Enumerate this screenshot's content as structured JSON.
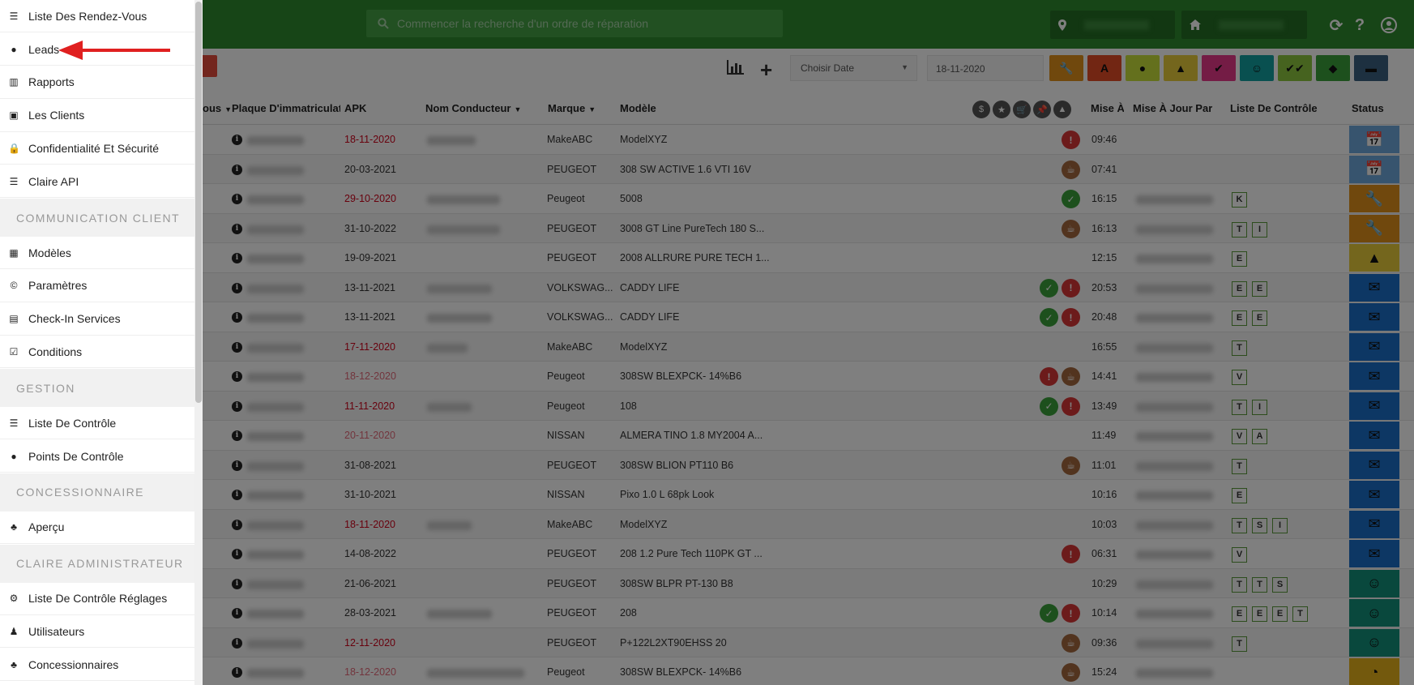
{
  "header": {
    "search_placeholder": "Commencer la recherche d'un ordre de réparation"
  },
  "toolbar": {
    "date_select": "Choisir Date",
    "date_value": "18-11-2020",
    "filter_buttons": [
      {
        "name": "wrench",
        "color": "#e0901a",
        "glyph": "🔧"
      },
      {
        "name": "alert-box",
        "color": "#e44d26",
        "glyph": "A"
      },
      {
        "name": "tag",
        "color": "#c8e03a",
        "glyph": "●"
      },
      {
        "name": "warning",
        "color": "#e8cc3a",
        "glyph": "▲"
      },
      {
        "name": "user-check",
        "color": "#e8388a",
        "glyph": "✔"
      },
      {
        "name": "face",
        "color": "#13a0a0",
        "glyph": "☺"
      },
      {
        "name": "double-check",
        "color": "#8cc63f",
        "glyph": "✔✔"
      },
      {
        "name": "shield",
        "color": "#3aa03a",
        "glyph": "◆"
      },
      {
        "name": "car",
        "color": "#3a6080",
        "glyph": "▬"
      }
    ]
  },
  "table": {
    "headers": {
      "col0": "ous",
      "plate": "Plaque D'immatriculatio",
      "apk": "APK",
      "driver": "Nom Conducteur",
      "brand": "Marque",
      "model": "Modèle",
      "update": "Mise À",
      "updated_by": "Mise À Jour Par",
      "checklist": "Liste De Contrôle",
      "status": "Status"
    },
    "header_icons": [
      "$",
      "★",
      "🛒",
      "📌",
      "▲"
    ],
    "rows": [
      {
        "apk": "18-11-2020",
        "apk_color": "red",
        "brand": "MakeABC",
        "model": "ModelXYZ",
        "time": "09:46",
        "icons": [
          "red"
        ],
        "checks": [],
        "status": "lightblue",
        "status_glyph": "📅"
      },
      {
        "apk": "20-03-2021",
        "apk_color": "normal",
        "brand": "PEUGEOT",
        "model": "308 SW ACTIVE 1.6 VTI 16V",
        "time": "07:41",
        "icons": [
          "brown"
        ],
        "checks": [],
        "status": "lightblue",
        "status_glyph": "📅"
      },
      {
        "apk": "29-10-2020",
        "apk_color": "red",
        "brand": "Peugeot",
        "model": "5008",
        "time": "16:15",
        "icons": [
          "green"
        ],
        "checks": [
          "K"
        ],
        "status": "orange",
        "status_glyph": "🔧"
      },
      {
        "apk": "31-10-2022",
        "apk_color": "normal",
        "brand": "PEUGEOT",
        "model": "3008 GT Line PureTech 180 S...",
        "time": "16:13",
        "icons": [
          "brown"
        ],
        "checks": [
          "T",
          "I"
        ],
        "status": "orange",
        "status_glyph": "🔧"
      },
      {
        "apk": "19-09-2021",
        "apk_color": "normal",
        "brand": "PEUGEOT",
        "model": "2008 ALLRURE PURE TECH 1...",
        "time": "12:15",
        "icons": [],
        "checks": [
          "E"
        ],
        "status": "yellow",
        "status_glyph": "▲"
      },
      {
        "apk": "13-11-2021",
        "apk_color": "normal",
        "brand": "VOLKSWAG...",
        "model": "CADDY LIFE",
        "time": "20:53",
        "icons": [
          "green",
          "red"
        ],
        "checks": [
          "E",
          "E"
        ],
        "status": "blue",
        "status_glyph": "✉"
      },
      {
        "apk": "13-11-2021",
        "apk_color": "normal",
        "brand": "VOLKSWAG...",
        "model": "CADDY LIFE",
        "time": "20:48",
        "icons": [
          "green",
          "red"
        ],
        "checks": [
          "E",
          "E"
        ],
        "status": "blue",
        "status_glyph": "✉"
      },
      {
        "apk": "17-11-2020",
        "apk_color": "red",
        "brand": "MakeABC",
        "model": "ModelXYZ",
        "time": "16:55",
        "icons": [],
        "checks": [
          "T"
        ],
        "status": "blue",
        "status_glyph": "✉"
      },
      {
        "apk": "18-12-2020",
        "apk_color": "pink",
        "brand": "Peugeot",
        "model": "308SW BLEXPCK- 14%B6",
        "time": "14:41",
        "icons": [
          "red",
          "brown"
        ],
        "checks": [
          "V"
        ],
        "status": "blue",
        "status_glyph": "✉"
      },
      {
        "apk": "11-11-2020",
        "apk_color": "red",
        "brand": "Peugeot",
        "model": "108",
        "time": "13:49",
        "icons": [
          "green",
          "red"
        ],
        "checks": [
          "T",
          "I"
        ],
        "status": "blue",
        "status_glyph": "✉"
      },
      {
        "apk": "20-11-2020",
        "apk_color": "pink",
        "brand": "NISSAN",
        "model": "ALMERA TINO 1.8 MY2004 A...",
        "time": "11:49",
        "icons": [],
        "checks": [
          "V",
          "A"
        ],
        "status": "blue",
        "status_glyph": "✉"
      },
      {
        "apk": "31-08-2021",
        "apk_color": "normal",
        "brand": "PEUGEOT",
        "model": "308SW BLION PT110 B6",
        "time": "11:01",
        "icons": [
          "brown"
        ],
        "checks": [
          "T"
        ],
        "status": "blue",
        "status_glyph": "✉"
      },
      {
        "apk": "31-10-2021",
        "apk_color": "normal",
        "brand": "NISSAN",
        "model": "Pixo 1.0 L 68pk Look",
        "time": "10:16",
        "icons": [],
        "checks": [
          "E"
        ],
        "status": "blue",
        "status_glyph": "✉"
      },
      {
        "apk": "18-11-2020",
        "apk_color": "red",
        "brand": "MakeABC",
        "model": "ModelXYZ",
        "time": "10:03",
        "icons": [],
        "checks": [
          "T",
          "S",
          "I"
        ],
        "status": "blue",
        "status_glyph": "✉"
      },
      {
        "apk": "14-08-2022",
        "apk_color": "normal",
        "brand": "PEUGEOT",
        "model": "208 1.2 Pure Tech 110PK GT ...",
        "time": "06:31",
        "icons": [
          "red"
        ],
        "checks": [
          "V"
        ],
        "status": "blue",
        "status_glyph": "✉"
      },
      {
        "apk": "21-06-2021",
        "apk_color": "normal",
        "brand": "PEUGEOT",
        "model": "308SW BLPR PT-130 B8",
        "time": "10:29",
        "icons": [],
        "checks": [
          "T",
          "T",
          "S"
        ],
        "status": "teal",
        "status_glyph": "☺"
      },
      {
        "apk": "28-03-2021",
        "apk_color": "normal",
        "brand": "PEUGEOT",
        "model": "208",
        "time": "10:14",
        "icons": [
          "green",
          "red"
        ],
        "checks": [
          "E",
          "E",
          "E",
          "T"
        ],
        "status": "teal",
        "status_glyph": "☺"
      },
      {
        "apk": "12-11-2020",
        "apk_color": "red",
        "brand": "PEUGEOT",
        "model": "P+122L2XT90EHSS 20",
        "time": "09:36",
        "icons": [
          "brown"
        ],
        "checks": [
          "T"
        ],
        "status": "teal",
        "status_glyph": "☺"
      },
      {
        "apk": "18-12-2020",
        "apk_color": "pink",
        "brand": "Peugeot",
        "model": "308SW BLEXPCK- 14%B6",
        "time": "15:24",
        "icons": [
          "brown"
        ],
        "checks": [],
        "status": "gold",
        "status_glyph": "◔"
      }
    ]
  },
  "sidebar": {
    "items": [
      {
        "type": "item",
        "label": "Liste Des Rendez-Vous",
        "icon": "list-icon",
        "glyph": "☰"
      },
      {
        "type": "item",
        "label": "Leads",
        "icon": "clock-icon",
        "glyph": "●"
      },
      {
        "type": "item",
        "label": "Rapports",
        "icon": "bar-chart-icon",
        "glyph": "▥"
      },
      {
        "type": "item",
        "label": "Les Clients",
        "icon": "id-card-icon",
        "glyph": "▣"
      },
      {
        "type": "item",
        "label": "Confidentialité Et Sécurité",
        "icon": "lock-icon",
        "glyph": "🔒"
      },
      {
        "type": "item",
        "label": "Claire API",
        "icon": "server-icon",
        "glyph": "☰"
      },
      {
        "type": "section",
        "label": "COMMUNICATION CLIENT"
      },
      {
        "type": "item",
        "label": "Modèles",
        "icon": "film-icon",
        "glyph": "▦"
      },
      {
        "type": "item",
        "label": "Paramètres",
        "icon": "cc-icon",
        "glyph": "©"
      },
      {
        "type": "item",
        "label": "Check-In Services",
        "icon": "table-icon",
        "glyph": "▤"
      },
      {
        "type": "item",
        "label": "Conditions",
        "icon": "checkbox-icon",
        "glyph": "☑"
      },
      {
        "type": "section",
        "label": "GESTION"
      },
      {
        "type": "item",
        "label": "Liste De Contrôle",
        "icon": "list-ul-icon",
        "glyph": "☰"
      },
      {
        "type": "item",
        "label": "Points De Contrôle",
        "icon": "comment-icon",
        "glyph": "●"
      },
      {
        "type": "section",
        "label": "CONCESSIONNAIRE"
      },
      {
        "type": "item",
        "label": "Aperçu",
        "icon": "sitemap-icon",
        "glyph": "♣"
      },
      {
        "type": "section",
        "label": "CLAIRE ADMINISTRATEUR"
      },
      {
        "type": "item",
        "label": "Liste De Contrôle Réglages",
        "icon": "cogs-icon",
        "glyph": "⚙"
      },
      {
        "type": "item",
        "label": "Utilisateurs",
        "icon": "users-icon",
        "glyph": "♟"
      },
      {
        "type": "item",
        "label": "Concessionnaires",
        "icon": "sitemap-icon",
        "glyph": "♣"
      }
    ]
  },
  "annotation": {
    "color": "#e02020",
    "target": "Leads"
  }
}
